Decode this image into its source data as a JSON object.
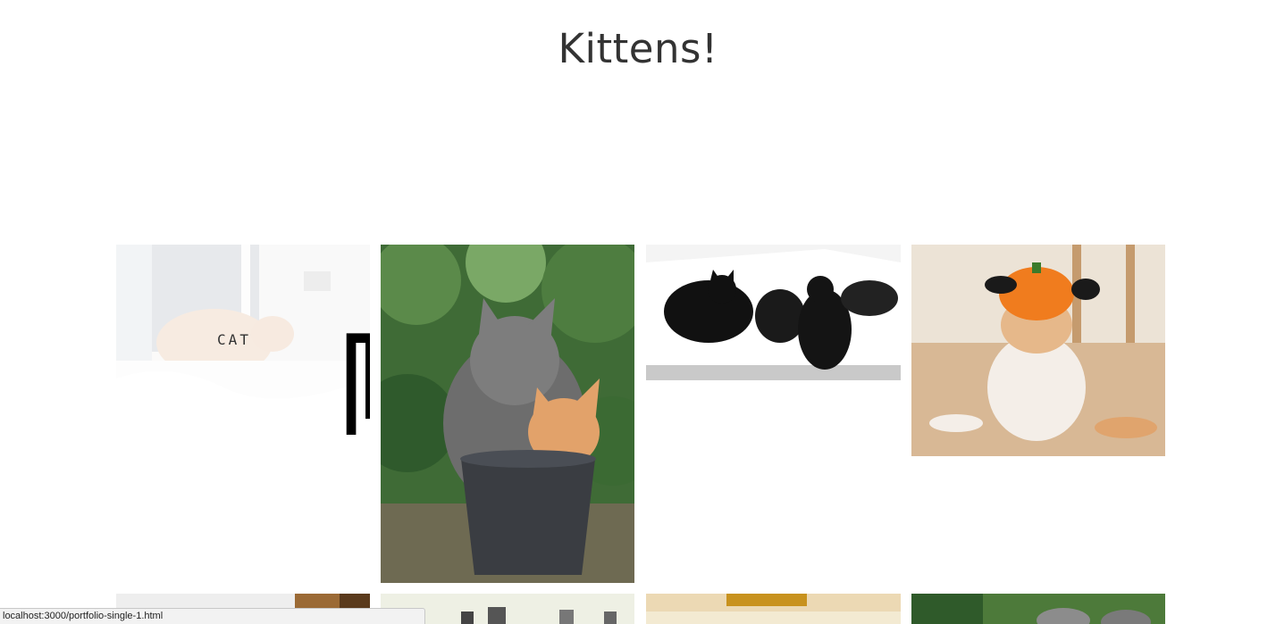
{
  "page": {
    "title": "Kittens!"
  },
  "gallery": {
    "items": [
      {
        "id": "cat-in-doorway",
        "hover_label": "CAT",
        "hovered": true
      },
      {
        "id": "kittens-in-pot"
      },
      {
        "id": "black-cats-on-sofa"
      },
      {
        "id": "cat-in-pumpkin-hat"
      },
      {
        "id": "row2-kitchen-cat"
      },
      {
        "id": "row2-cats-on-shelf"
      },
      {
        "id": "row2-cat-on-bed"
      },
      {
        "id": "row2-kittens-outdoors"
      }
    ]
  },
  "cursor": {
    "icon": "hand-pointer-icon"
  },
  "status_bar": {
    "url": "localhost:3000/portfolio-single-1.html"
  },
  "colors": {
    "title": "#333333",
    "background": "#ffffff"
  }
}
